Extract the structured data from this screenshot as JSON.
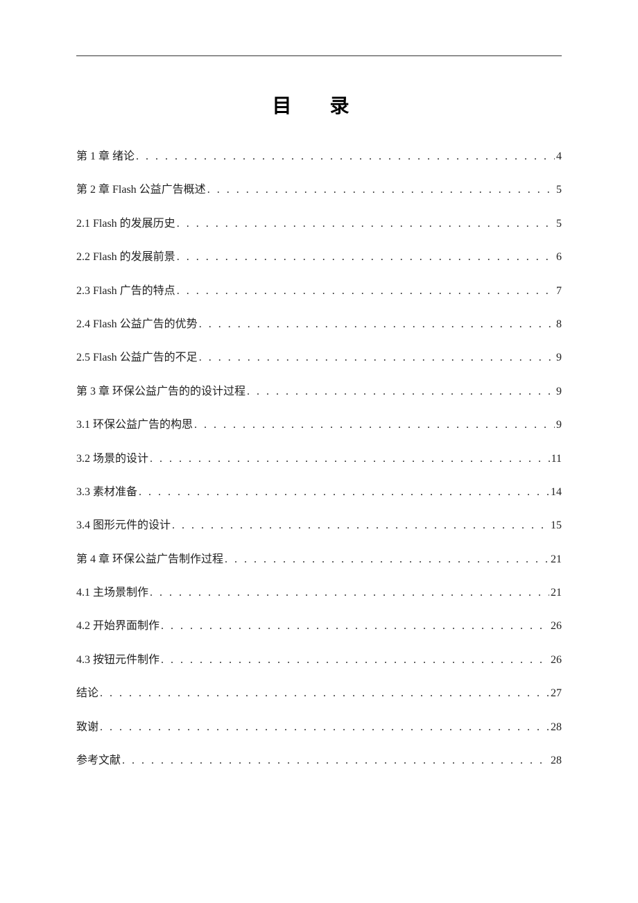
{
  "title": "目  录",
  "toc": [
    {
      "label": "第 1 章  绪论",
      "page": "4"
    },
    {
      "label": "第 2 章  Flash 公益广告概述",
      "page": "5"
    },
    {
      "label": "2.1   Flash 的发展历史",
      "page": "5"
    },
    {
      "label": "2.2   Flash 的发展前景",
      "page": "6"
    },
    {
      "label": "2.3   Flash 广告的特点",
      "page": "7"
    },
    {
      "label": "2.4   Flash 公益广告的优势",
      "page": "8"
    },
    {
      "label": "2.5  Flash 公益广告的不足",
      "page": "9"
    },
    {
      "label": "第 3 章  环保公益广告的的设计过程",
      "page": "9"
    },
    {
      "label": "3.1   环保公益广告的构思",
      "page": "9"
    },
    {
      "label": "3.2   场景的设计",
      "page": "11"
    },
    {
      "label": "3.3   素材准备",
      "page": "14"
    },
    {
      "label": "3.4   图形元件的设计",
      "page": "15"
    },
    {
      "label": "第 4 章  环保公益广告制作过程",
      "page": "21"
    },
    {
      "label": "4.1 主场景制作",
      "page": "21"
    },
    {
      "label": "4.2 开始界面制作",
      "page": "26"
    },
    {
      "label": "4.3 按钮元件制作",
      "page": "26"
    },
    {
      "label": "结论",
      "page": "27"
    },
    {
      "label": "致谢",
      "page": "28"
    },
    {
      "label": "参考文献",
      "page": "28"
    }
  ]
}
